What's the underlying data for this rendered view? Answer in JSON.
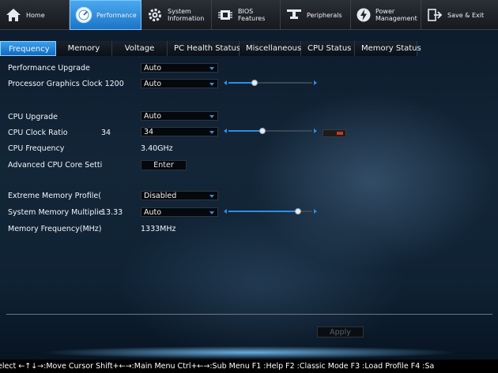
{
  "topnav": [
    {
      "id": "home",
      "label": "Home",
      "icon": "home-icon",
      "active": false
    },
    {
      "id": "performance",
      "label": "Performance",
      "icon": "speedometer-icon",
      "active": true
    },
    {
      "id": "system-information",
      "label": "System\nInformation",
      "icon": "gear-icon",
      "active": false
    },
    {
      "id": "bios-features",
      "label": "BIOS\nFeatures",
      "icon": "chip-icon",
      "active": false
    },
    {
      "id": "peripherals",
      "label": "Peripherals",
      "icon": "peripherals-icon",
      "active": false
    },
    {
      "id": "power-management",
      "label": "Power\nManagement",
      "icon": "power-icon",
      "active": false
    },
    {
      "id": "save-exit",
      "label": "Save & Exit",
      "icon": "exit-icon",
      "active": false
    }
  ],
  "subtabs": [
    "Frequency",
    "Memory",
    "Voltage",
    "PC Health Status",
    "Miscellaneous",
    "CPU Status",
    "Memory Status"
  ],
  "active_subtab": "Frequency",
  "settings": {
    "performance_upgrade": {
      "label": "Performance Upgrade",
      "value": "Auto"
    },
    "processor_graphics_clock": {
      "label": "Processor Graphics Clock",
      "current": "1200",
      "value": "Auto",
      "slider_percent": 31
    },
    "cpu_upgrade": {
      "label": "CPU Upgrade",
      "value": "Auto"
    },
    "cpu_clock_ratio": {
      "label": "CPU Clock Ratio",
      "current": "34",
      "value": "34",
      "slider_percent": 41
    },
    "cpu_frequency": {
      "label": "CPU Frequency",
      "value": "3.40GHz"
    },
    "advanced_cpu_core": {
      "label": "Advanced CPU Core Setti",
      "button": "Enter"
    },
    "extreme_memory_profile": {
      "label": "Extreme Memory Profile(",
      "value": "Disabled"
    },
    "system_memory_multiplier": {
      "label": "System Memory Multiplie",
      "current": "13.33",
      "value": "Auto",
      "slider_percent": 83
    },
    "memory_frequency": {
      "label": "Memory Frequency(MHz)",
      "value": "1333MHz"
    }
  },
  "apply_label": "Apply",
  "status_bar": "elect ←↑↓→:Move Cursor Shift+←→:Main Menu Ctrl+←→:Sub Menu F1 :Help F2 :Classic Mode F3 :Load Profile F4 :Sa",
  "colors": {
    "accent": "#2a8fe8",
    "toggle_on": "#c2382d"
  }
}
